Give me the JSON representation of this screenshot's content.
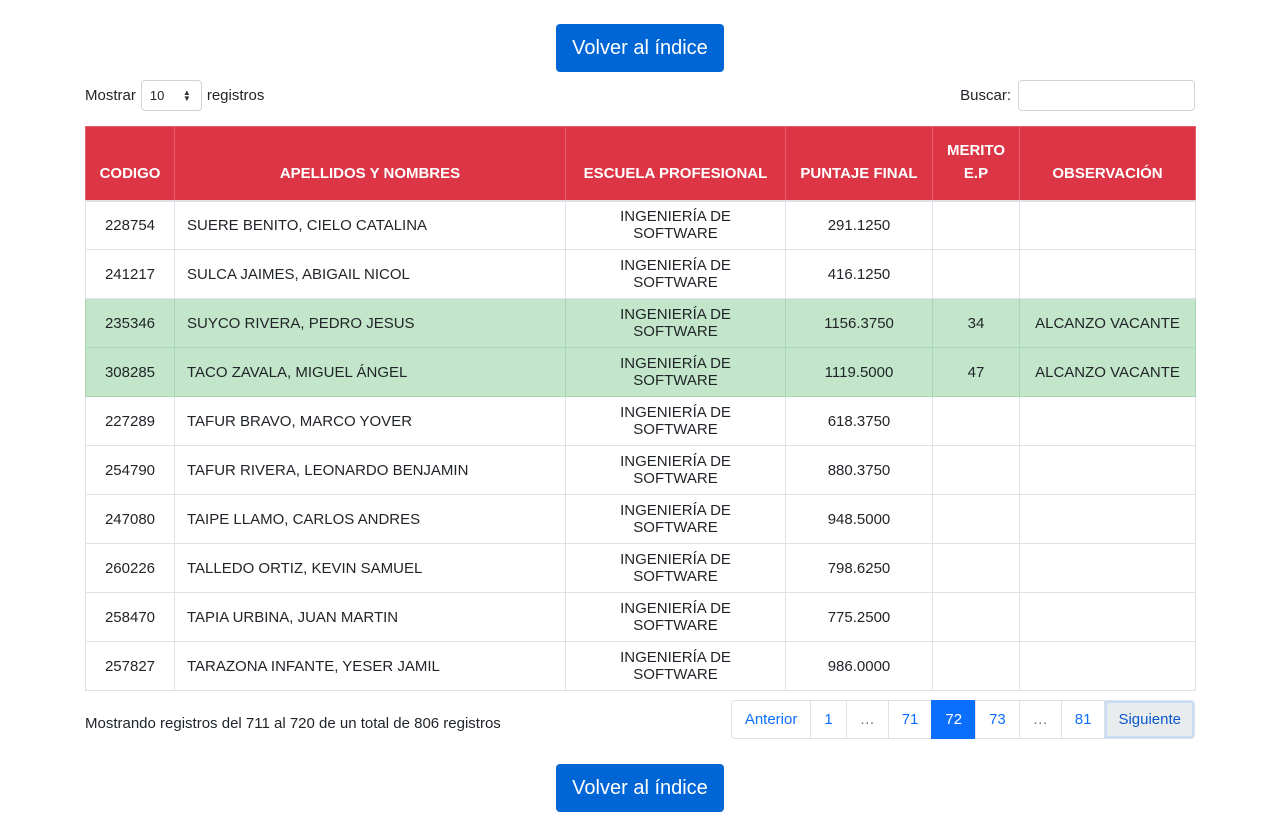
{
  "buttons": {
    "back_to_index": "Volver al índice"
  },
  "length_control": {
    "prefix": "Mostrar",
    "value": "10",
    "suffix": "registros"
  },
  "search": {
    "label": "Buscar:",
    "value": "",
    "placeholder": ""
  },
  "table": {
    "headers": {
      "codigo": "CODIGO",
      "nombres": "APELLIDOS Y NOMBRES",
      "escuela": "ESCUELA PROFESIONAL",
      "puntaje": "PUNTAJE FINAL",
      "merito_line1": "MERITO",
      "merito_line2": "E.P",
      "observacion": "OBSERVACIÓN"
    },
    "rows": [
      {
        "codigo": "228754",
        "nombre": "SUERE BENITO, CIELO CATALINA",
        "escuela": "INGENIERÍA DE SOFTWARE",
        "puntaje": "291.1250",
        "merito": "",
        "observacion": "",
        "highlight": false
      },
      {
        "codigo": "241217",
        "nombre": "SULCA JAIMES, ABIGAIL NICOL",
        "escuela": "INGENIERÍA DE SOFTWARE",
        "puntaje": "416.1250",
        "merito": "",
        "observacion": "",
        "highlight": false
      },
      {
        "codigo": "235346",
        "nombre": "SUYCO RIVERA, PEDRO JESUS",
        "escuela": "INGENIERÍA DE SOFTWARE",
        "puntaje": "1156.3750",
        "merito": "34",
        "observacion": "ALCANZO VACANTE",
        "highlight": true
      },
      {
        "codigo": "308285",
        "nombre": "TACO ZAVALA, MIGUEL ÁNGEL",
        "escuela": "INGENIERÍA DE SOFTWARE",
        "puntaje": "1119.5000",
        "merito": "47",
        "observacion": "ALCANZO VACANTE",
        "highlight": true
      },
      {
        "codigo": "227289",
        "nombre": "TAFUR BRAVO, MARCO YOVER",
        "escuela": "INGENIERÍA DE SOFTWARE",
        "puntaje": "618.3750",
        "merito": "",
        "observacion": "",
        "highlight": false
      },
      {
        "codigo": "254790",
        "nombre": "TAFUR RIVERA, LEONARDO BENJAMIN",
        "escuela": "INGENIERÍA DE SOFTWARE",
        "puntaje": "880.3750",
        "merito": "",
        "observacion": "",
        "highlight": false
      },
      {
        "codigo": "247080",
        "nombre": "TAIPE LLAMO, CARLOS ANDRES",
        "escuela": "INGENIERÍA DE SOFTWARE",
        "puntaje": "948.5000",
        "merito": "",
        "observacion": "",
        "highlight": false
      },
      {
        "codigo": "260226",
        "nombre": "TALLEDO ORTIZ, KEVIN SAMUEL",
        "escuela": "INGENIERÍA DE SOFTWARE",
        "puntaje": "798.6250",
        "merito": "",
        "observacion": "",
        "highlight": false
      },
      {
        "codigo": "258470",
        "nombre": "TAPIA URBINA, JUAN MARTIN",
        "escuela": "INGENIERÍA DE SOFTWARE",
        "puntaje": "775.2500",
        "merito": "",
        "observacion": "",
        "highlight": false
      },
      {
        "codigo": "257827",
        "nombre": "TARAZONA INFANTE, YESER JAMIL",
        "escuela": "INGENIERÍA DE SOFTWARE",
        "puntaje": "986.0000",
        "merito": "",
        "observacion": "",
        "highlight": false
      }
    ]
  },
  "info": "Mostrando registros del 711 al 720 de un total de 806 registros",
  "pagination": {
    "previous": "Anterior",
    "pages": [
      "1",
      "…",
      "71",
      "72",
      "73",
      "…",
      "81"
    ],
    "active_page": "72",
    "next": "Siguiente"
  },
  "colors": {
    "header_bg": "#dc3545",
    "highlight_row": "#c3e6cb",
    "primary_button": "#0066d6",
    "active_page": "#0b6efd"
  }
}
